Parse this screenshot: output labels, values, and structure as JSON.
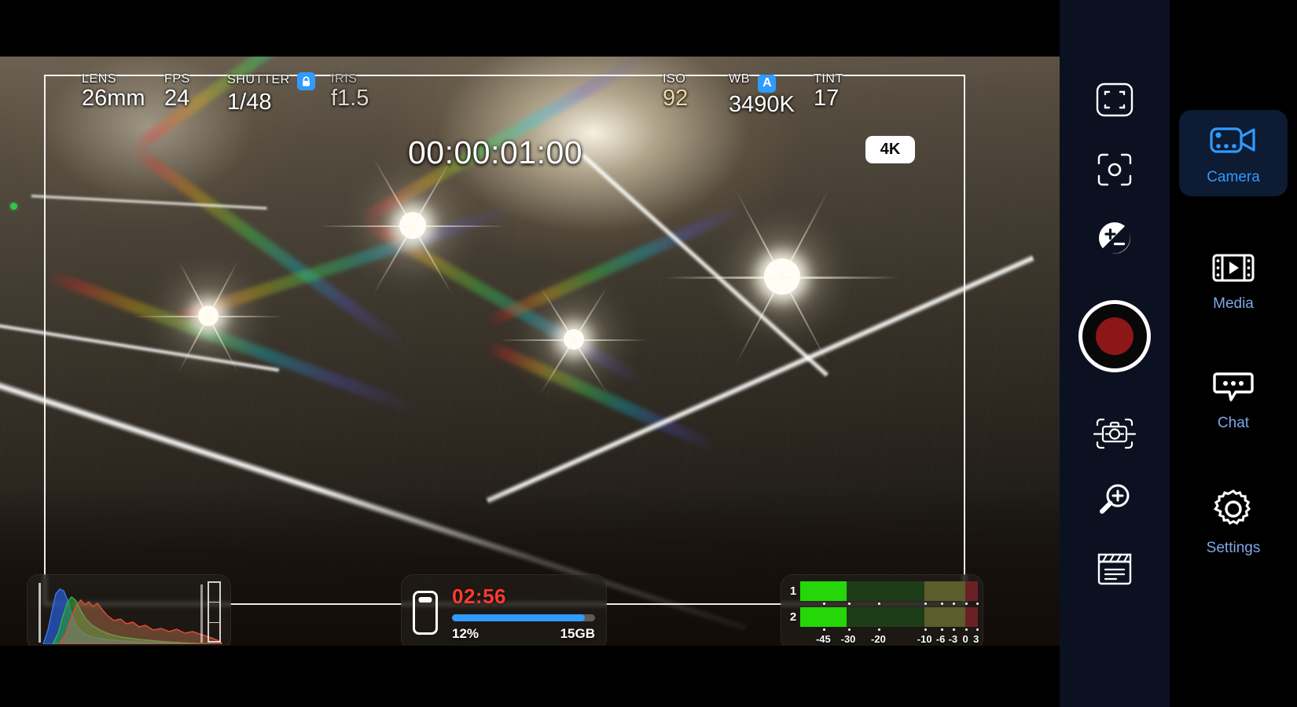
{
  "hud": {
    "lens": {
      "label": "LENS",
      "value": "26mm"
    },
    "fps": {
      "label": "FPS",
      "value": "24"
    },
    "shutter": {
      "label": "SHUTTER",
      "value": "1/48",
      "locked": true,
      "lock_icon": "lock-icon"
    },
    "iris": {
      "label": "IRIS",
      "value": "f1.5"
    },
    "timecode": "00:00:01:00",
    "iso": {
      "label": "ISO",
      "value": "92"
    },
    "wb": {
      "label": "WB",
      "value": "3490K",
      "auto_badge": "A"
    },
    "tint": {
      "label": "TINT",
      "value": "17"
    },
    "resolution_badge": "4K"
  },
  "histogram": {
    "name": "rgb-histogram",
    "channels": [
      "red",
      "green",
      "blue"
    ]
  },
  "storage": {
    "battery_icon": "battery-icon",
    "remaining_time": "02:56",
    "battery_percent": "12%",
    "free_space": "15GB",
    "bar_fill_percent": 93,
    "bar_color": "#2f9bff",
    "time_color": "#ff3b2f"
  },
  "audio": {
    "channels": [
      {
        "label": "1",
        "level_percent": 26
      },
      {
        "label": "2",
        "level_percent": 26
      }
    ],
    "scale": [
      "-45",
      "-30",
      "-20",
      "-10",
      "-6",
      "-3",
      "0",
      "3"
    ],
    "scale_positions": [
      13,
      27,
      44,
      70,
      79,
      86,
      93,
      99
    ],
    "green_color": "#25d709"
  },
  "rail": {
    "buttons": [
      {
        "name": "framing-guide-icon",
        "label": "Framing guides"
      },
      {
        "name": "focus-reticle-icon",
        "label": "Focus"
      },
      {
        "name": "exposure-compensation-icon",
        "label": "Exposure compensation"
      },
      {
        "name": "record-button",
        "label": "Record"
      },
      {
        "name": "camera-stabilizer-icon",
        "label": "Stabilization"
      },
      {
        "name": "zoom-in-icon",
        "label": "Zoom"
      },
      {
        "name": "clapperboard-icon",
        "label": "Slate"
      }
    ]
  },
  "nav": {
    "items": [
      {
        "label": "Camera",
        "icon": "video-camera-icon",
        "active": true
      },
      {
        "label": "Media",
        "icon": "film-play-icon",
        "active": false
      },
      {
        "label": "Chat",
        "icon": "chat-bubble-icon",
        "active": false
      },
      {
        "label": "Settings",
        "icon": "gear-icon",
        "active": false
      }
    ]
  },
  "colors": {
    "accent": "#2f9bff",
    "rail_bg": "#0b1120",
    "nav_active_bg": "#0d1b33",
    "record_red": "#8d1616"
  }
}
